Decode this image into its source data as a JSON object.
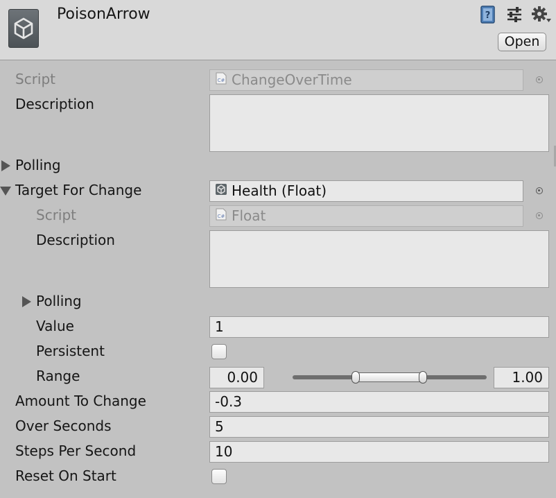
{
  "header": {
    "title": "PoisonArrow",
    "open_button": "Open",
    "icons": [
      "unity-logo-icon",
      "help-book-icon",
      "preset-sliders-icon",
      "gear-menu-icon"
    ]
  },
  "fields": {
    "script": {
      "label": "Script",
      "value": "ChangeOverTime"
    },
    "description": {
      "label": "Description",
      "value": ""
    },
    "polling": {
      "label": "Polling"
    },
    "target": {
      "label": "Target For Change",
      "value": "Health (Float)",
      "script": {
        "label": "Script",
        "value": "Float"
      },
      "description": {
        "label": "Description",
        "value": ""
      },
      "polling": {
        "label": "Polling"
      },
      "value_field": {
        "label": "Value",
        "value": "1"
      },
      "persistent": {
        "label": "Persistent",
        "checked": false
      },
      "range": {
        "label": "Range",
        "min": "0.00",
        "max": "1.00",
        "slider_min": 0.0,
        "slider_max": 1.0
      }
    },
    "amount_to_change": {
      "label": "Amount To Change",
      "value": "-0.3"
    },
    "over_seconds": {
      "label": "Over Seconds",
      "value": "5"
    },
    "steps_per_second": {
      "label": "Steps Per Second",
      "value": "10"
    },
    "reset_on_start": {
      "label": "Reset On Start",
      "checked": false
    }
  },
  "colors": {
    "header_bg": "#d9d9d9",
    "panel_bg": "#c2c2c2",
    "field_bg": "#e8e8e8",
    "disabled_text": "#7e7e7e"
  }
}
